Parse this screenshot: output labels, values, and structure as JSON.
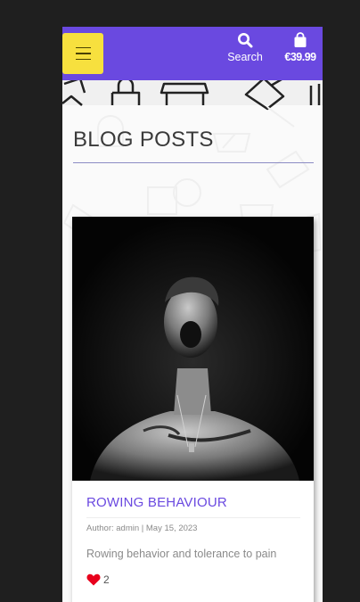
{
  "navbar": {
    "search_label": "Search",
    "cart_total": "€39.99",
    "bg_color": "#6a49e0",
    "menu_color": "#f7e03e"
  },
  "page": {
    "title": "BLOG POSTS"
  },
  "post": {
    "title": "ROWING BEHAVIOUR",
    "meta": "Author: admin | May 15, 2023",
    "excerpt": "Rowing behavior and tolerance to pain",
    "likes": "2",
    "like_icon": "heart-icon"
  }
}
